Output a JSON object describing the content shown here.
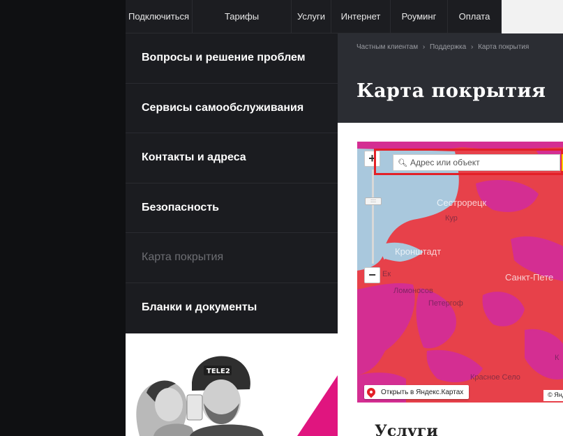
{
  "topnav": {
    "items": [
      "Подключиться",
      "Тарифы",
      "Услуги",
      "Интернет",
      "Роуминг",
      "Оплата"
    ]
  },
  "sidebar": {
    "items": [
      {
        "label": "Вопросы и решение проблем"
      },
      {
        "label": "Сервисы самообслуживания"
      },
      {
        "label": "Контакты и адреса"
      },
      {
        "label": "Безопасность"
      },
      {
        "label": "Карта покрытия",
        "active": true
      },
      {
        "label": "Бланки и документы"
      }
    ]
  },
  "promo": {
    "helmet_text": "TELE2"
  },
  "breadcrumb": [
    "Частным клиентам",
    "›",
    "Поддержка",
    "›",
    "Карта покрытия"
  ],
  "page": {
    "title": "Карта покрытия"
  },
  "map": {
    "search_placeholder": "Адрес или объект",
    "zoom_in": "+",
    "zoom_out": "−",
    "labels": {
      "sestroretsk": "Сестрорецк",
      "kurort": "Кур",
      "kronshtadt": "Кронштадт",
      "spb": "Санкт-Пете",
      "lomonosov": "Ломоносов",
      "petergof": "Петергоф",
      "ksel": "Красное Село",
      "chk": "К",
      "ek": "Ек"
    },
    "open_link": "Открыть в Яндекс.Картах",
    "copyright": "© Янд",
    "colors": {
      "coverage_red": "#e7414a",
      "coverage_magenta": "#d42e92",
      "water": "#a9c8dd",
      "accent": "#e32027"
    }
  },
  "services": {
    "title": "Услуги"
  }
}
